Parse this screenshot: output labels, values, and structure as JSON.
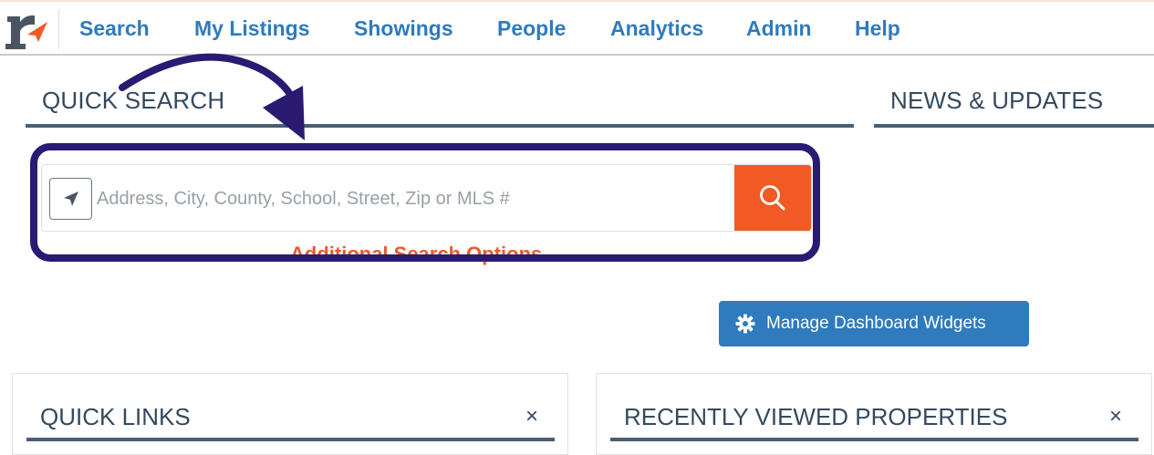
{
  "nav": {
    "logo_alt": "r",
    "items": [
      {
        "label": "Search"
      },
      {
        "label": "My Listings"
      },
      {
        "label": "Showings"
      },
      {
        "label": "People"
      },
      {
        "label": "Analytics"
      },
      {
        "label": "Admin"
      },
      {
        "label": "Help"
      }
    ]
  },
  "quick_search": {
    "title": "QUICK SEARCH",
    "placeholder": "Address, City, County, School, Street, Zip or MLS #",
    "additional_options": "Additional Search Options",
    "locate_icon": "location-arrow-icon",
    "search_icon": "magnifier-icon"
  },
  "news": {
    "title": "NEWS & UPDATES"
  },
  "manage_widgets": {
    "label": "Manage Dashboard Widgets",
    "icon": "gear-icon"
  },
  "panels": {
    "quick_links": {
      "title": "QUICK LINKS",
      "close": "×"
    },
    "recently_viewed": {
      "title": "RECENTLY VIEWED PROPERTIES",
      "close": "×"
    }
  },
  "colors": {
    "nav_link": "#2f7bbd",
    "accent_orange": "#f15a24",
    "annotation_frame": "#2a1a72",
    "section_rule": "#4a5d72"
  }
}
